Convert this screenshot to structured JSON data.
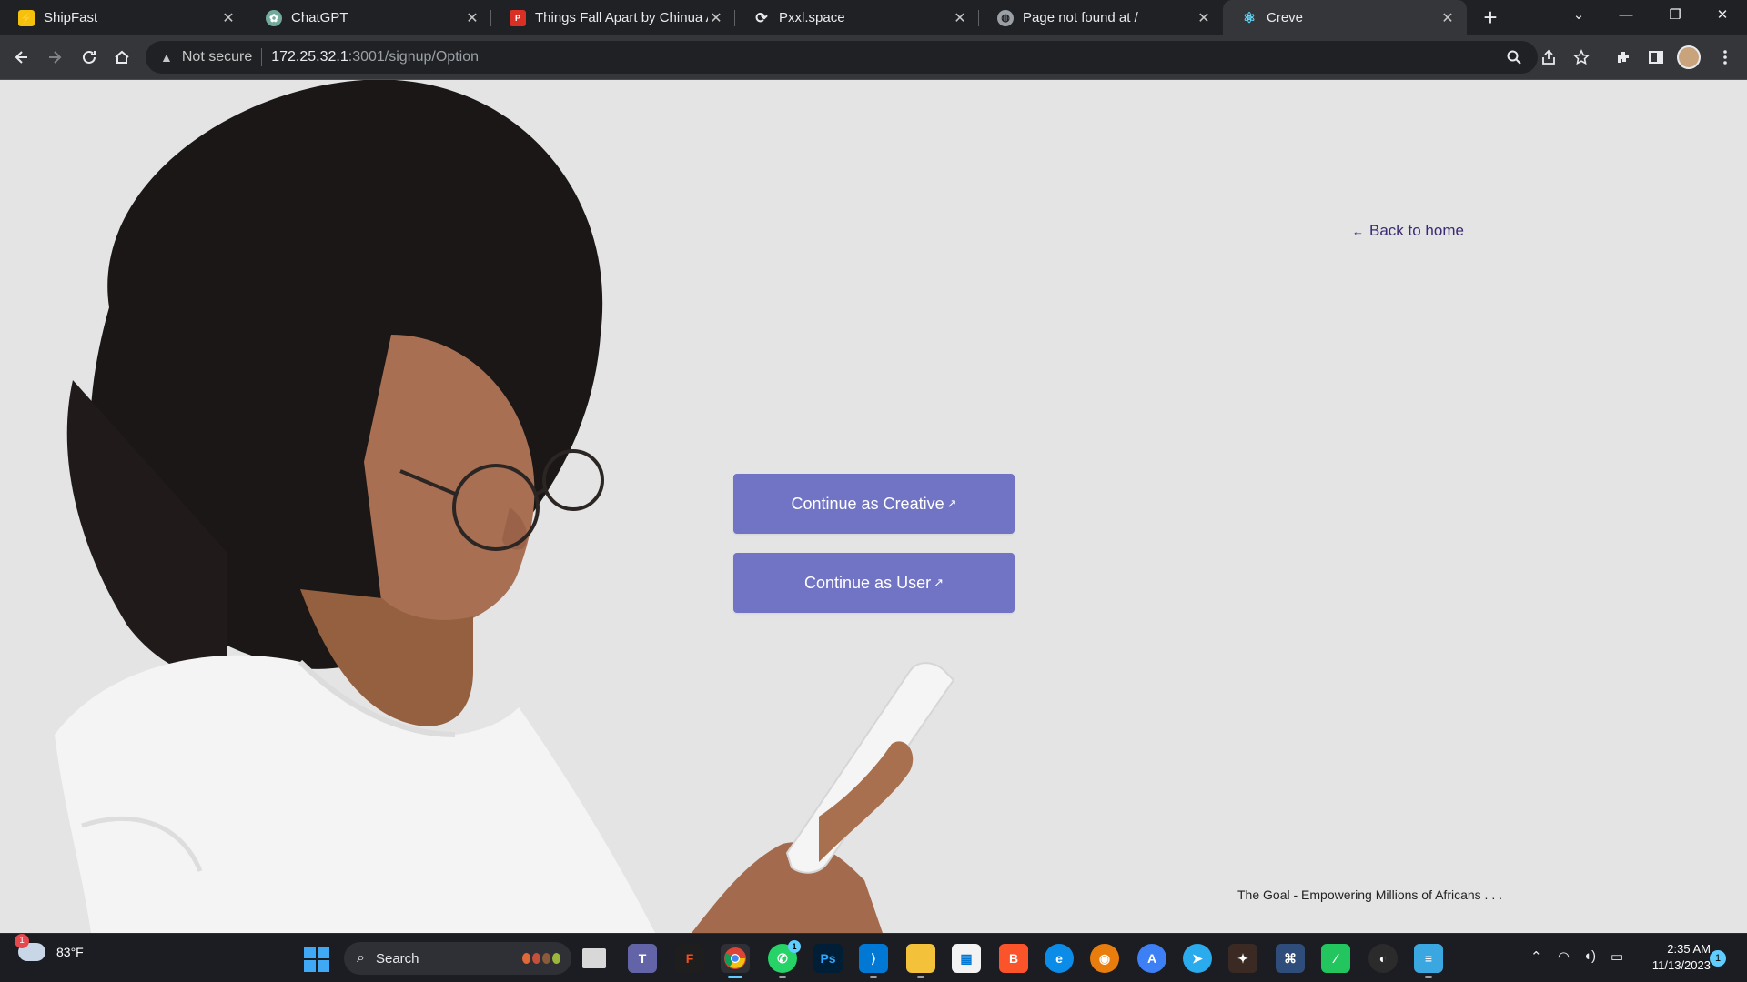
{
  "browser": {
    "tabs": [
      {
        "title": "ShipFast",
        "favicon": "bolt-icon",
        "fav_color": "#f4c20d"
      },
      {
        "title": "ChatGPT",
        "favicon": "openai-icon",
        "fav_color": "#74aa9c"
      },
      {
        "title": "Things Fall Apart by Chinua Achebe",
        "favicon": "pdf-icon",
        "fav_color": "#d93025"
      },
      {
        "title": "Pxxl.space",
        "favicon": "sync-icon",
        "fav_color": "#e8eaed"
      },
      {
        "title": "Page not found at /",
        "favicon": "globe-icon",
        "fav_color": "#9aa0a6"
      },
      {
        "title": "Creve",
        "favicon": "react-icon",
        "fav_color": "#61dafb"
      }
    ],
    "active_tab": 5,
    "new_tab_symbol": "+",
    "address": {
      "security_label": "Not secure",
      "host": "172.25.32.1",
      "path": ":3001/signup/Option"
    }
  },
  "page": {
    "back_link": "Back to home",
    "back_arrow": "←",
    "cta_creative": "Continue as Creative",
    "cta_user": "Continue as User",
    "external_arrow": "↗",
    "tagline": "The Goal - Empowering Millions of Africans . . .",
    "colors": {
      "button": "#7174c4",
      "link": "#3b2a73",
      "background": "#e4e4e4"
    }
  },
  "taskbar": {
    "weather_temp": "83°F",
    "weather_badge": "1",
    "search_label": "Search",
    "whatsapp_badge": "1",
    "time": "2:35 AM",
    "date": "11/13/2023",
    "notification_count": "1",
    "apps": [
      "task-view-icon",
      "teams-icon",
      "figma-icon",
      "chrome-icon",
      "whatsapp-icon",
      "photoshop-icon",
      "vscode-icon",
      "file-explorer-icon",
      "store-icon",
      "brave-icon",
      "edge-icon",
      "blender-icon",
      "app-icon",
      "telegram-icon",
      "game-icon",
      "app-icon",
      "app-icon",
      "obs-icon",
      "notepad-icon"
    ]
  }
}
